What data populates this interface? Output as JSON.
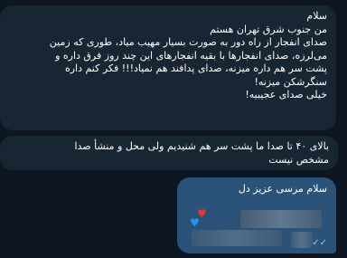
{
  "messages": [
    {
      "id": "msg1",
      "direction": "incoming",
      "text": "سلام\nمن جنوب شرق تهران هستم\nصدای انفجار از راه دور به صورت بسیار مهیب میاد، طوری که زمین\nمی‌لرزه، صدای انفجارها با بقیه انفجارهای این چند روز فرق داره و\nپشت سر هم داره میزنه، صدای پدافند هم نمیاد!!! فکر کنم داره\nسنگرشکن میزنه!\nخیلی صدای عجیبیه!"
    },
    {
      "id": "msg2",
      "direction": "incoming",
      "text": "بالای ۴۰ تا صدا ما پشت سر هم شنیدیم ولی محل و منشأ صدا\nمشخص نیست"
    },
    {
      "id": "msg3",
      "direction": "outgoing",
      "text": "سلام مرسی عزیز دل",
      "status_icon": "double-check-icon",
      "status_glyph": "✓✓"
    }
  ],
  "reactions": {
    "heart_red": "♥",
    "heart_blue": "♥"
  },
  "colors": {
    "background": "#0e1621",
    "incoming_bubble": "#182533",
    "outgoing_bubble": "#2b5278"
  }
}
